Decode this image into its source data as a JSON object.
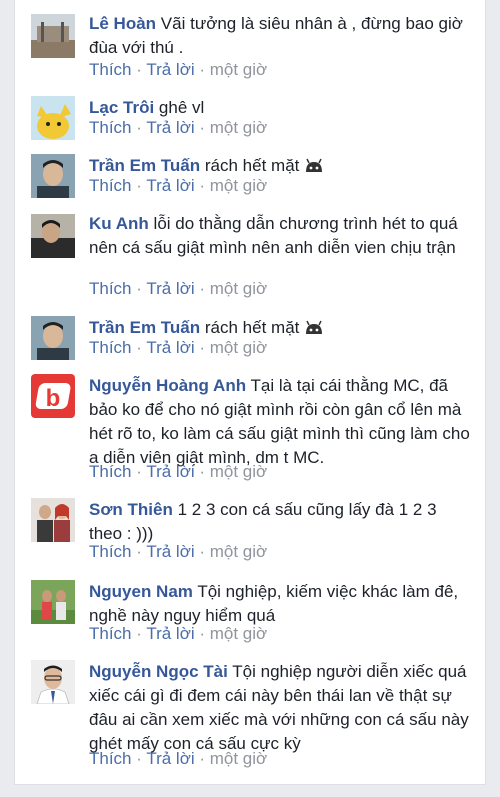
{
  "actions": {
    "like": "Thích",
    "reply": "Trả lời",
    "separator": " · "
  },
  "comments": [
    {
      "author": "Lê Hoàn",
      "text": "Vãi tưởng là siêu nhân à , đừng bao giờ đùa với thú .",
      "time": "một giờ",
      "avatar_color": "#7a6a5a"
    },
    {
      "author": "Lạc Trôi",
      "text": "ghê vl",
      "time": "một giờ",
      "avatar_color": "#f2c935"
    },
    {
      "author": "Trần Em Tuấn",
      "text": "rách hết mặt",
      "time": "một giờ",
      "avatar_color": "#3d4650",
      "emoji": "android-emoji-icon"
    },
    {
      "author": "Ku Anh",
      "text": "lỗi do thằng dẫn chương trình hét to quá nên cá sấu giật mình nên anh diễn vien chịu trận",
      "time": "một giờ",
      "avatar_color": "#2b2b2b"
    },
    {
      "author": "Trần Em Tuấn",
      "text": "rách hết mặt",
      "time": "một giờ",
      "avatar_color": "#3d4650",
      "emoji": "android-emoji-icon"
    },
    {
      "author": "Nguyễn Hoàng Anh",
      "text": "Tại là tại cái thằng MC, đã bảo ko để cho nó giật mình rồi còn gân cổ lên mà hét rõ to, ko làm cá sấu giật mình thì cũng làm cho a diễn viên giật mình, dm t MC.",
      "time": "một giờ",
      "avatar_color": "#e53935",
      "avatar_letter": "b"
    },
    {
      "author": "Sơn Thiên",
      "text": "1 2 3 con cá sấu cũng lấy đà 1 2 3 theo : )))",
      "time": "một giờ",
      "avatar_color": "#d9d4cf"
    },
    {
      "author": "Nguyen Nam",
      "text": "Tội nghiệp, kiếm việc khác làm đê, nghề này nguy hiểm quá",
      "time": "một giờ",
      "avatar_color": "#6f9a4f"
    },
    {
      "author": "Nguyễn Ngọc Tài",
      "text": "Tội nghiệp người diễn xiếc quá xiếc cái gì đi đem cái này bên thái lan về thật sự đâu ai cần xem xiếc mà với những con cá sấu này ghét mấy con cá sấu cực kỳ",
      "time": "một giờ",
      "avatar_color": "#e8e8e8"
    }
  ]
}
